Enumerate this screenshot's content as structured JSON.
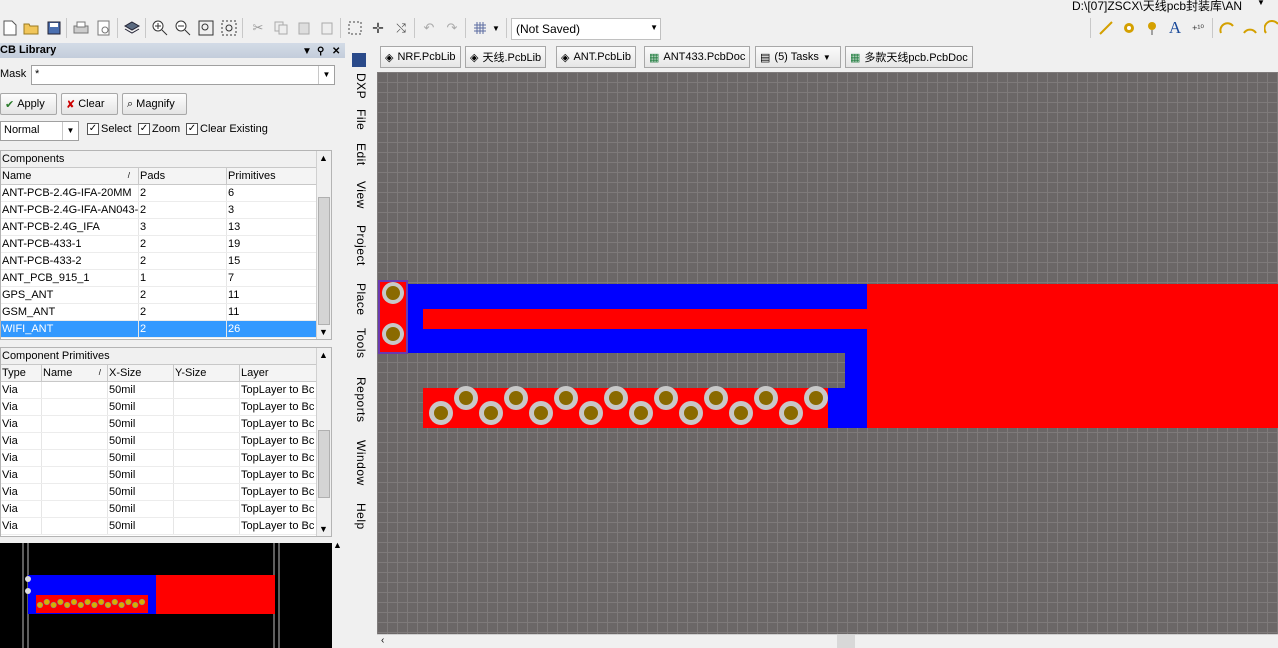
{
  "window": {
    "path": "D:\\[07]ZSCX\\天线pcb封装库\\AN",
    "snap_status": "(Not Saved)"
  },
  "toolbar": {
    "icons": [
      "new-icon",
      "open-icon",
      "save-icon",
      "print-icon",
      "print-preview-icon",
      "layers-icon",
      "zoom-in-icon",
      "zoom-out-icon",
      "zoom-fit-icon",
      "zoom-area-icon",
      "cut-icon",
      "copy-icon",
      "paste-icon",
      "rubber-stamp-icon",
      "select-area-icon",
      "move-icon",
      "cross-probe-icon",
      "undo-icon",
      "redo-icon",
      "grid-icon"
    ]
  },
  "library": {
    "title": "CB Library",
    "mask_label": "Mask",
    "mask_value": "*",
    "buttons": {
      "apply": "Apply",
      "clear": "Clear",
      "magnify": "Magnify"
    },
    "mode": "Normal",
    "options": {
      "select": "Select",
      "zoom": "Zoom",
      "clear_existing": "Clear Existing"
    },
    "components": {
      "title": "Components",
      "headers": [
        "Name",
        "Pads",
        "Primitives"
      ],
      "rows": [
        [
          "ANT-PCB-2.4G-IFA-20MM",
          "2",
          "6"
        ],
        [
          "ANT-PCB-2.4G-IFA-AN043-T",
          "2",
          "3"
        ],
        [
          "ANT-PCB-2.4G_IFA",
          "3",
          "13"
        ],
        [
          "ANT-PCB-433-1",
          "2",
          "19"
        ],
        [
          "ANT-PCB-433-2",
          "2",
          "15"
        ],
        [
          "ANT_PCB_915_1",
          "1",
          "7"
        ],
        [
          "GPS_ANT",
          "2",
          "11"
        ],
        [
          "GSM_ANT",
          "2",
          "11"
        ],
        [
          "WIFI_ANT",
          "2",
          "26"
        ]
      ]
    },
    "primitives": {
      "title": "Component Primitives",
      "headers": [
        "Type",
        "Name",
        "X-Size",
        "Y-Size",
        "Layer"
      ],
      "rows": [
        [
          "Via",
          "",
          "50mil",
          "",
          "TopLayer to Bc"
        ],
        [
          "Via",
          "",
          "50mil",
          "",
          "TopLayer to Bc"
        ],
        [
          "Via",
          "",
          "50mil",
          "",
          "TopLayer to Bc"
        ],
        [
          "Via",
          "",
          "50mil",
          "",
          "TopLayer to Bc"
        ],
        [
          "Via",
          "",
          "50mil",
          "",
          "TopLayer to Bc"
        ],
        [
          "Via",
          "",
          "50mil",
          "",
          "TopLayer to Bc"
        ],
        [
          "Via",
          "",
          "50mil",
          "",
          "TopLayer to Bc"
        ],
        [
          "Via",
          "",
          "50mil",
          "",
          "TopLayer to Bc"
        ],
        [
          "Via",
          "",
          "50mil",
          "",
          "TopLayer to Bc"
        ]
      ]
    }
  },
  "menu": [
    "DXP",
    "File",
    "Edit",
    "View",
    "Project",
    "Place",
    "Tools",
    "Reports",
    "Window",
    "Help"
  ],
  "tabs": [
    "NRF.PcbLib",
    "天线.PcbLib",
    "ANT.PcbLib",
    "ANT433.PcbDoc",
    "(5) Tasks",
    "多款天线pcb.PcbDoc"
  ],
  "colors": {
    "top_layer": "#ff0000",
    "bottom_layer": "#0000ff",
    "via_ring": "#c8c8c8",
    "via_hole": "#8a6a00",
    "canvas": "#6b6767"
  }
}
